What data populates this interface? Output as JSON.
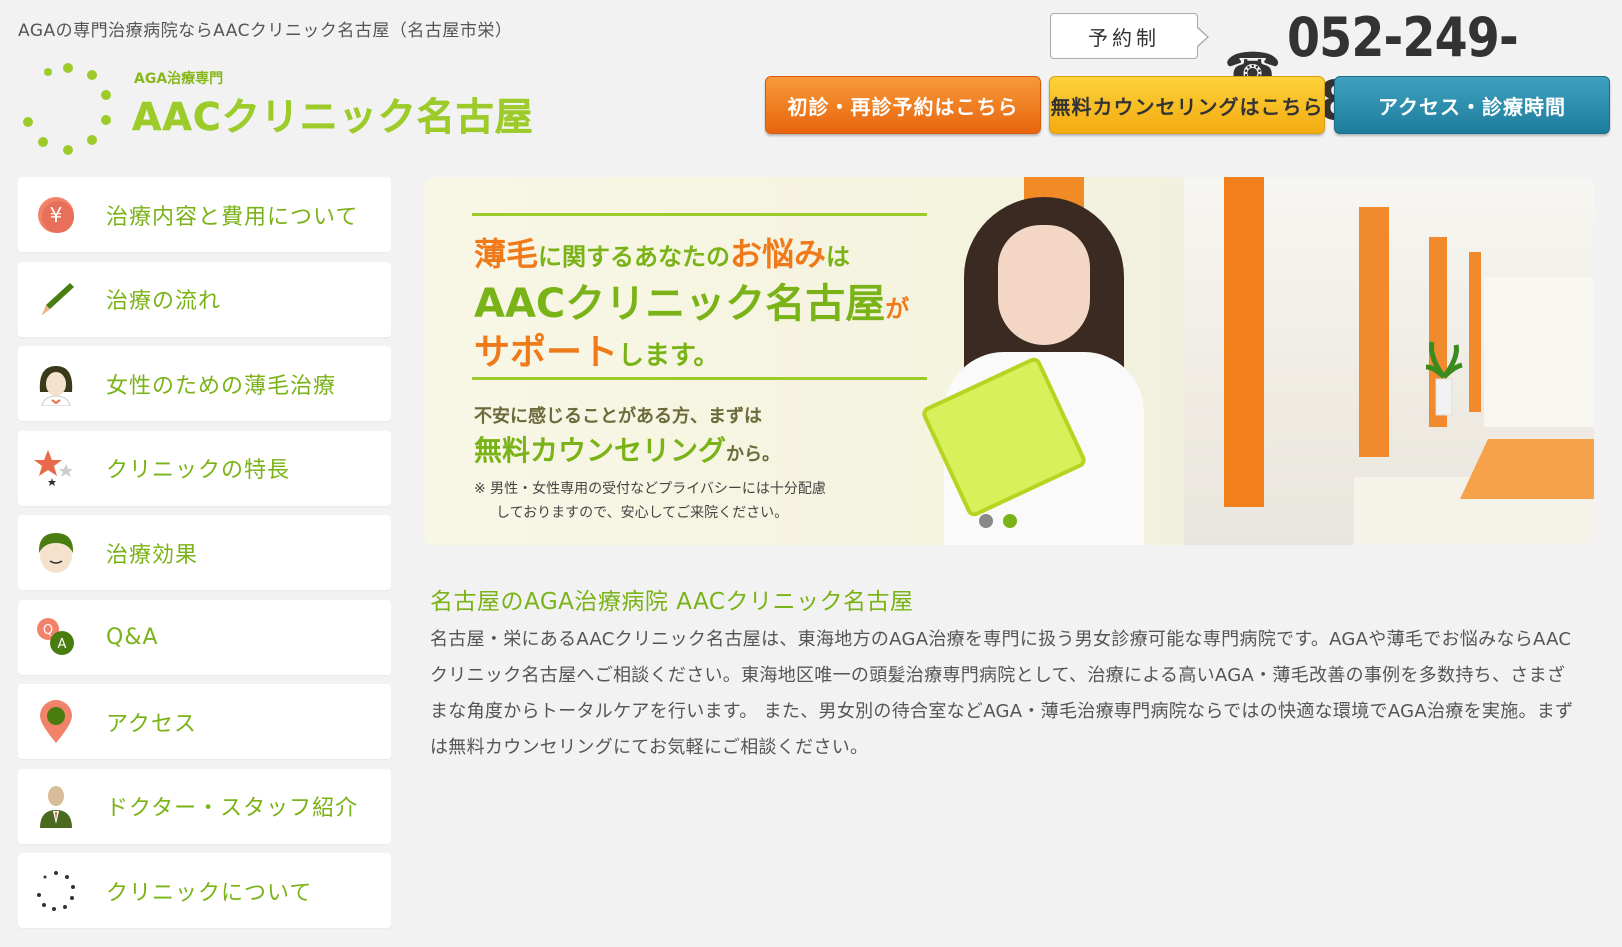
{
  "header": {
    "tagline": "AGAの専門治療病院ならAAC​クリニック名古屋（名古屋市栄）",
    "logo_small": "AGA治療専門",
    "logo_main": "AACクリニック名古屋",
    "reserve_label": "予約制",
    "phone_icon": "☎",
    "phone_number": "052-249-8880",
    "buttons": {
      "reserve": "初診・再診予約はこちら",
      "counseling": "無料カウンセリングはこちら",
      "access": "アクセス・診療時間"
    }
  },
  "sidebar": {
    "items": [
      {
        "label": "治療内容と費用について",
        "icon": "yen-icon"
      },
      {
        "label": "治療の流れ",
        "icon": "pencil-icon"
      },
      {
        "label": "女性のための薄毛治療",
        "icon": "woman-icon"
      },
      {
        "label": "クリニックの特長",
        "icon": "stars-icon"
      },
      {
        "label": "治療効果",
        "icon": "man-icon"
      },
      {
        "label": "Q&A",
        "icon": "qa-icon"
      },
      {
        "label": "アクセス",
        "icon": "map-pin-icon"
      },
      {
        "label": "ドクター・スタッフ紹介",
        "icon": "doctor-icon"
      },
      {
        "label": "クリニックについて",
        "icon": "dots-ring-icon"
      }
    ]
  },
  "banner": {
    "line1_a": "薄毛",
    "line1_b": "に関するあなたの",
    "line1_c": "お悩み",
    "line1_d": "は",
    "line2_a": "AACクリニック名古屋",
    "line2_b": "が",
    "line3_a": "サポート",
    "line3_b": "します。",
    "sub": "不安に感じることがある方、まずは",
    "free": "無料カウンセリング",
    "free_suffix": "から。",
    "note_line1": "※ 男性・女性専用の受付などプライバシーには十分配慮",
    "note_line2": "しておりますので、安心してご来院ください。",
    "slides": 2,
    "active_slide": 2
  },
  "content": {
    "heading": "名古屋のAGA治療病院 AACクリニック名古屋",
    "body": "名古屋・栄にあるAACクリニック名古屋は、東海地方のAGA治療を専門に扱う男女診療可能な専門病院です。AGAや薄毛でお悩みならAACクリニック名古屋へご相談ください。東海地区唯一の頭髪治療専門病院として、治療による高いAGA・薄毛改善の事例を多数持ち、さまざまな角度からトータルケアを行います。 また、男女別の待合室などAGA・薄毛治療専門病院ならではの快適な環境でAGA治療を実施。まずは無料カウンセリングにてお気軽にご相談ください。"
  },
  "colors": {
    "brand_green": "#7ab317",
    "orange": "#e8650e",
    "yellow": "#f3ab10",
    "blue": "#1e7d9c"
  }
}
